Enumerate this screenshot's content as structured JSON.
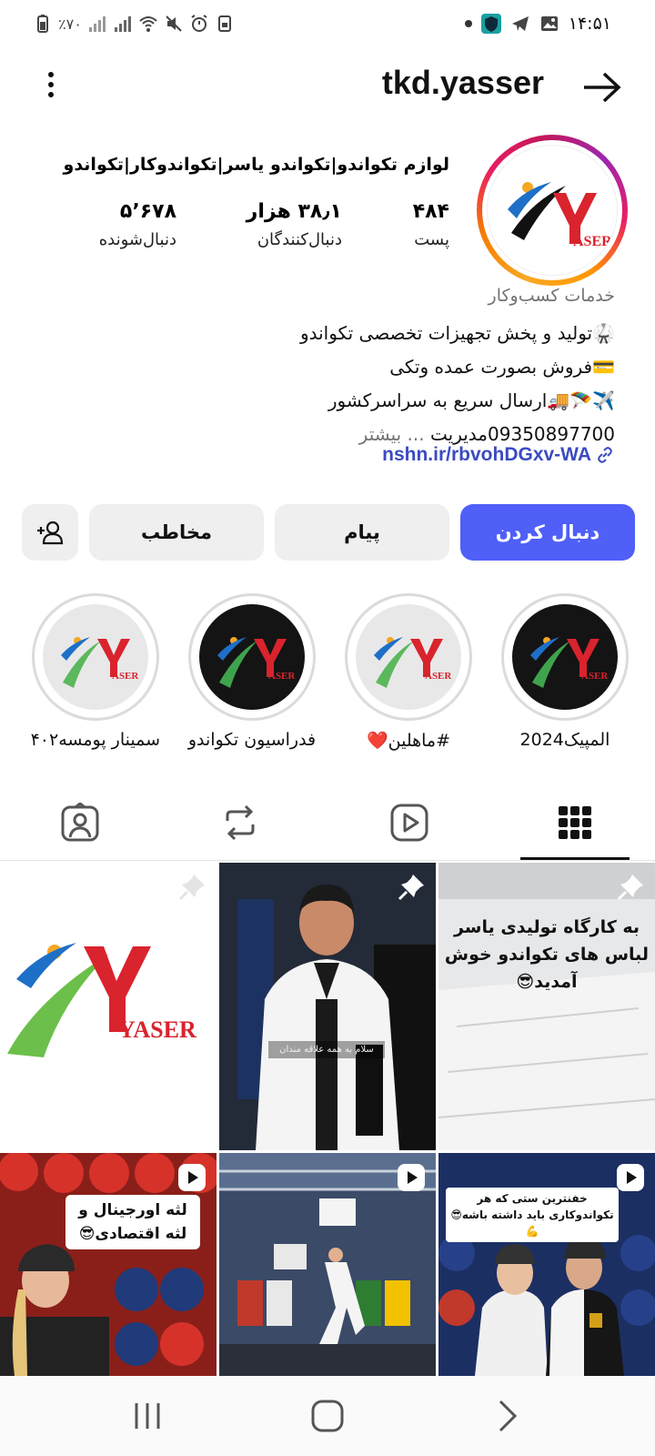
{
  "status_bar": {
    "battery": "٪۷۰",
    "time": "۱۴:۵۱"
  },
  "header": {
    "username": "tkd.yasser"
  },
  "profile": {
    "display_name": "لوازم تکواندو|تکواندو یاسر|تکواندوکار|تکواندو",
    "stats": [
      {
        "value": "۴۸۴",
        "label": "پست"
      },
      {
        "value": "۳۸٫۱ هزار",
        "label": "دنبال‌کنندگان"
      },
      {
        "value": "۵٬۶۷۸",
        "label": "دنبال‌شونده"
      }
    ],
    "category": "خدمات کسب‌وکار",
    "bio_lines": [
      "🥋تولید و پخش تجهیزات تخصصی تکواندو",
      "💳فروش بصورت عمده وتکی",
      "✈️🪂🚚ارسال سریع به سراسرکشور",
      "09350897700مدیریت"
    ],
    "bio_more": "... بیشتر",
    "link": "nshn.ir/rbvohDGxv-WA"
  },
  "buttons": {
    "follow": "دنبال کردن",
    "message": "پیام",
    "contact": "مخاطب"
  },
  "highlights": [
    {
      "label": "المپیک2024",
      "style": "dark"
    },
    {
      "label": "#ماهلین❤️",
      "style": "light"
    },
    {
      "label": "فدراسیون تکواندو",
      "style": "dark"
    },
    {
      "label": "سمینار پومسه۴۰۲",
      "style": "light"
    }
  ],
  "tabs": [
    "grid-icon",
    "reels-icon",
    "reposts-icon",
    "tagged-icon"
  ],
  "posts": [
    {
      "type": "logo",
      "pinned": true,
      "caption": ""
    },
    {
      "type": "photo",
      "pinned": true,
      "caption": "سلام به همه علاقه مندان"
    },
    {
      "type": "text",
      "pinned": true,
      "caption": "به کارگاه تولیدی یاسر لباس های تکواندو خوش آمدید😎"
    },
    {
      "type": "video",
      "pinned": false,
      "caption": "لثه اورجینال و لثه اقتصادی😎"
    },
    {
      "type": "video",
      "pinned": false,
      "caption": ""
    },
    {
      "type": "video",
      "pinned": false,
      "caption": "خفنترین ستی که هر تکواندوکاری باید داشته باشه😎💪"
    }
  ],
  "logo_text": "YASER",
  "colors": {
    "accent": "#4f5ff7",
    "link": "#3b4bbf",
    "logo_red": "#d9232d",
    "logo_green": "#5cb85c",
    "logo_blue": "#1e6fc7"
  }
}
